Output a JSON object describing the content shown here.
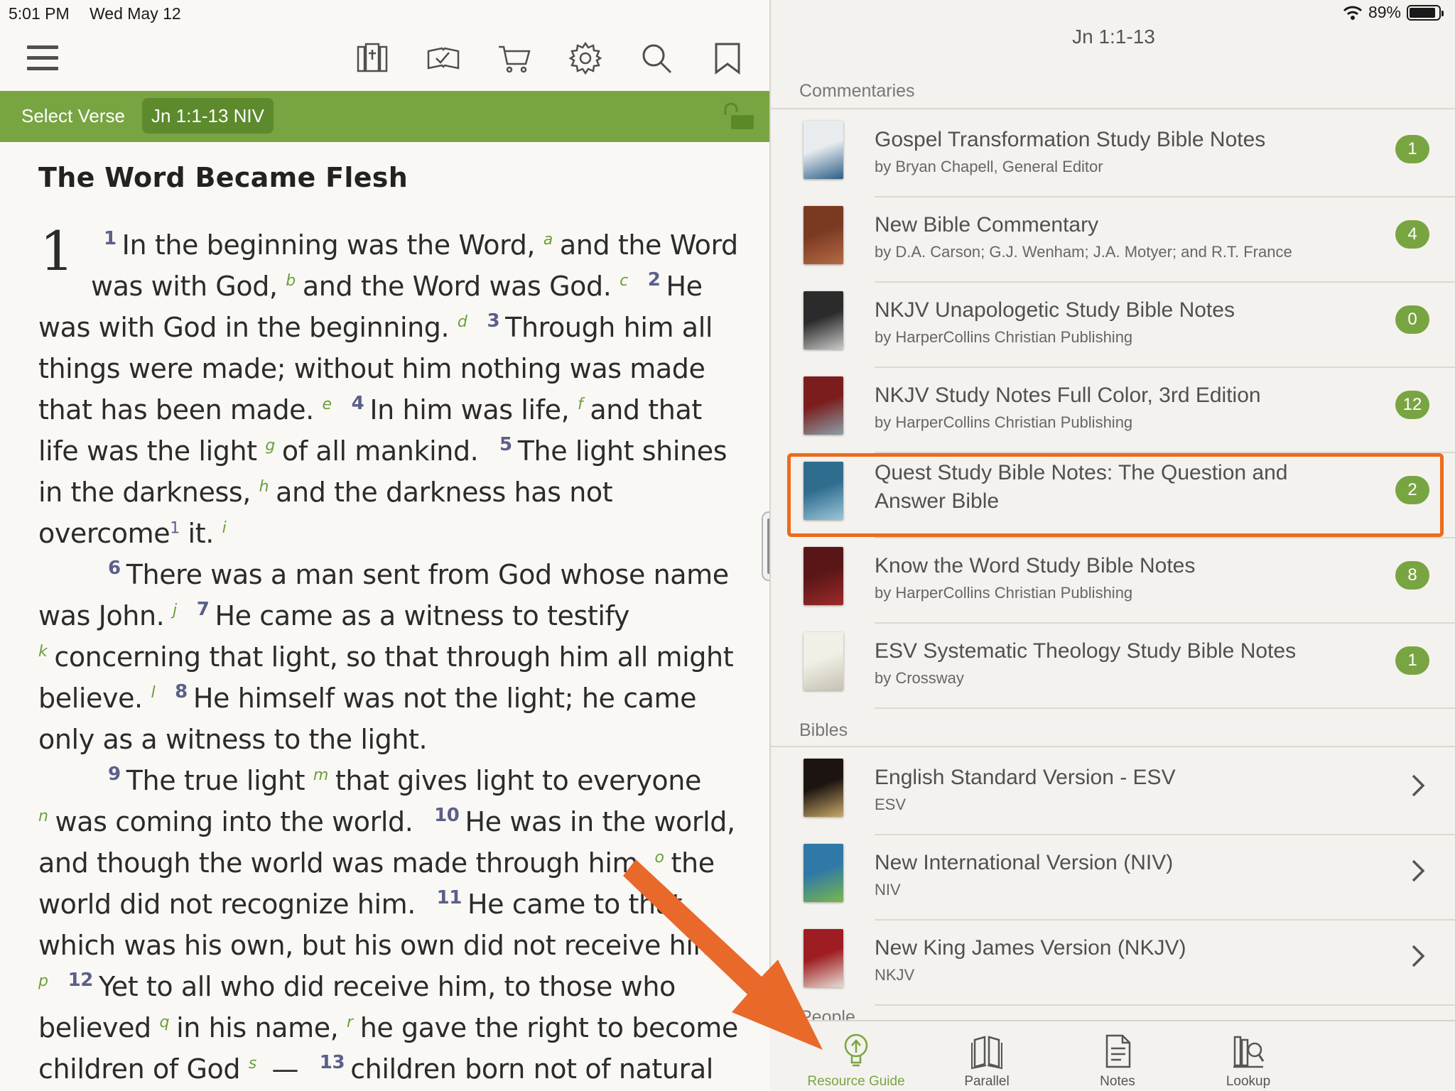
{
  "status_bar": {
    "time": "5:01 PM",
    "date": "Wed May 12",
    "battery": "89%",
    "battery_level": 0.89
  },
  "toolbar": {
    "icons": [
      "menu-icon",
      "library-icon",
      "reading-plans-icon",
      "cart-icon",
      "settings-icon",
      "search-icon",
      "bookmark-icon"
    ]
  },
  "verse_bar": {
    "select_label": "Select Verse",
    "reference": "Jn 1:1-13 NIV",
    "lock_icon": "unlock-icon"
  },
  "passage": {
    "heading": "The Word Became Flesh",
    "chapter": "1",
    "paragraphs": [
      [
        {
          "v": "1"
        },
        {
          "t": "In the beginning was the Word,"
        },
        {
          "f": "a"
        },
        {
          "t": "and the Word was with God,"
        },
        {
          "f": "b"
        },
        {
          "t": "and the Word was God."
        },
        {
          "f": "c"
        },
        {
          "v": "2"
        },
        {
          "t": "He was with God in the beginning."
        },
        {
          "f": "d"
        },
        {
          "v": "3"
        },
        {
          "t": "Through him all things were made; without him nothing was made that has been made."
        },
        {
          "f": "e"
        },
        {
          "v": "4"
        },
        {
          "t": "In him was life,"
        },
        {
          "f": "f"
        },
        {
          "t": "and that life was the light"
        },
        {
          "f": "g"
        },
        {
          "t": "of all mankind."
        },
        {
          "v": "5"
        },
        {
          "t": "The light shines in the dark­ness,"
        },
        {
          "f": "h"
        },
        {
          "t": "and the darkness has not overcome"
        },
        {
          "n": "1"
        },
        {
          "t": " it."
        },
        {
          "f": "i"
        }
      ],
      [
        {
          "v": "6"
        },
        {
          "t": "There was a man sent from God whose name was John."
        },
        {
          "f": "j"
        },
        {
          "v": "7"
        },
        {
          "t": "He came as a witness to testify"
        },
        {
          "f": "k"
        },
        {
          "t": "concerning that light, so that through him all might believe."
        },
        {
          "f": "l"
        },
        {
          "v": "8"
        },
        {
          "t": "He himself was not the light; he came only as a witness to the light."
        }
      ],
      [
        {
          "v": "9"
        },
        {
          "t": "The true light"
        },
        {
          "f": "m"
        },
        {
          "t": "that gives light to everyone"
        },
        {
          "f": "n"
        },
        {
          "t": "was coming into the world."
        },
        {
          "v": "10"
        },
        {
          "t": "He was in the world, and though the world was made through him,"
        },
        {
          "f": "o"
        },
        {
          "t": "the world did not recognize him."
        },
        {
          "v": "11"
        },
        {
          "t": "He came to that which was his own, but his own did not receive him."
        },
        {
          "f": "p"
        },
        {
          "v": "12"
        },
        {
          "t": "Yet to all who did receive him, to those who believed"
        },
        {
          "f": "q"
        },
        {
          "t": "in his name,"
        },
        {
          "f": "r"
        },
        {
          "t": "he gave the right to become children of God"
        },
        {
          "f": "s"
        },
        {
          "t": " —"
        },
        {
          "v": "13"
        },
        {
          "t": "children born not of natural descent, nor of human"
        }
      ]
    ]
  },
  "resource_guide": {
    "title": "Jn 1:1-13",
    "commentaries_label": "Commentaries",
    "commentaries": [
      {
        "title": "Gospel Transformation Study Bible Notes",
        "author": "by Bryan Chapell, General Editor",
        "count": "1",
        "cover": [
          "#e9ecef",
          "#2c5e86"
        ]
      },
      {
        "title": "New Bible Commentary",
        "author": "by D.A. Carson; G.J. Wenham; J.A. Motyer; and R.T. France",
        "count": "4",
        "cover": [
          "#7a3a22",
          "#b56b45"
        ]
      },
      {
        "title": "NKJV Unapologetic Study Bible Notes",
        "author": "by HarperCollins Christian Publishing",
        "count": "0",
        "cover": [
          "#2b2b2b",
          "#c9c9c9"
        ]
      },
      {
        "title": "NKJV Study Notes Full Color, 3rd Edition",
        "author": "by HarperCollins Christian Publishing",
        "count": "12",
        "cover": [
          "#7b1d1d",
          "#8aa0a8"
        ]
      },
      {
        "title": "Quest Study Bible Notes: The Question and Answer Bible",
        "author": "",
        "count": "2",
        "cover": [
          "#2f6d8f",
          "#9cc6d8"
        ]
      },
      {
        "title": "Know the Word Study Bible Notes",
        "author": "by HarperCollins Christian Publishing",
        "count": "8",
        "cover": [
          "#5a1616",
          "#9c2b2b"
        ]
      },
      {
        "title": "ESV Systematic Theology Study Bible Notes",
        "author": "by Crossway",
        "count": "1",
        "cover": [
          "#f1efe6",
          "#c5c1b2"
        ]
      }
    ],
    "bibles_label": "Bibles",
    "bibles": [
      {
        "title": "English Standard Version - ESV",
        "abbr": "ESV",
        "cover": [
          "#1c1410",
          "#c9a86a"
        ]
      },
      {
        "title": "New International Version (NIV)",
        "abbr": "NIV",
        "cover": [
          "#2f78a8",
          "#79b74a"
        ]
      },
      {
        "title": "New King James Version (NKJV)",
        "abbr": "NKJV",
        "cover": [
          "#9e1d22",
          "#e6dcd3"
        ]
      }
    ],
    "peek_label": "People"
  },
  "tab_bar": {
    "tabs": [
      {
        "label": "Resource Guide",
        "icon": "lightbulb-icon",
        "active": true
      },
      {
        "label": "Parallel",
        "icon": "parallel-books-icon",
        "active": false
      },
      {
        "label": "Notes",
        "icon": "notes-icon",
        "active": false
      },
      {
        "label": "Lookup",
        "icon": "lookup-icon",
        "active": false
      }
    ]
  },
  "colors": {
    "accent_green": "#79a442",
    "highlight_orange": "#ec6b1e",
    "verse_number": "#5b5f8a"
  }
}
